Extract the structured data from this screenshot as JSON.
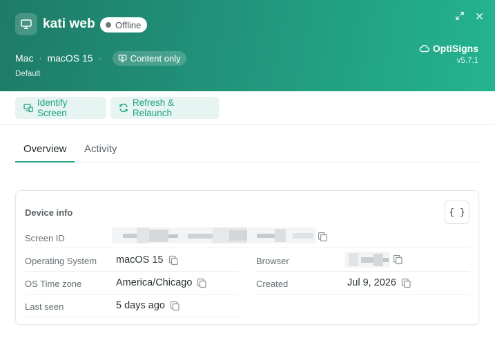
{
  "header": {
    "device_icon": "monitor-icon",
    "device_name": "kati web",
    "status": "Offline",
    "platform": "Mac",
    "separator": "·",
    "os": "macOS 15",
    "mode": "Content only",
    "group": "Default",
    "brand": "OptiSigns",
    "version": "v5.7.1",
    "expand_icon": "expand-icon",
    "close_icon": "close-icon",
    "brand_icon": "cloud-icon"
  },
  "toolbar": {
    "identify_label": "Identify Screen",
    "refresh_label": "Refresh & Relaunch"
  },
  "tabs": [
    {
      "label": "Overview",
      "active": true
    },
    {
      "label": "Activity",
      "active": false
    }
  ],
  "device_info": {
    "title": "Device info",
    "json_button": "{ }",
    "fields": {
      "screen_id_label": "Screen ID",
      "os_label": "Operating System",
      "os_value": "macOS 15",
      "browser_label": "Browser",
      "timezone_label": "OS Time zone",
      "timezone_value": "America/Chicago",
      "created_label": "Created",
      "created_value": "Jul 9, 2026",
      "last_seen_label": "Last seen",
      "last_seen_value": "5 days ago"
    }
  },
  "colors": {
    "accent": "#21a383",
    "header_start": "#1e7b67",
    "header_end": "#24b48f",
    "button_bg": "#e6f5f1"
  }
}
